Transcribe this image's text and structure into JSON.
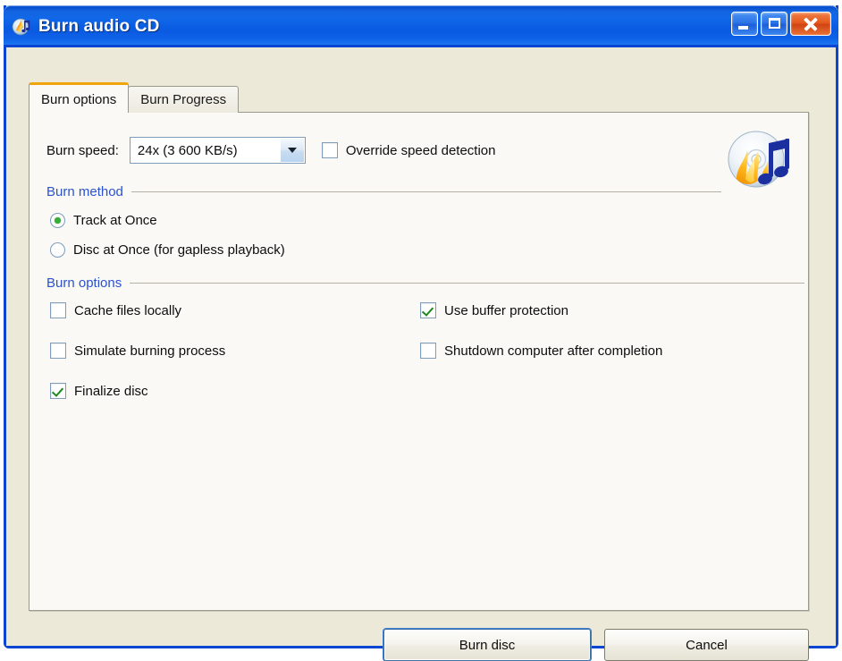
{
  "window": {
    "title": "Burn audio CD",
    "icon": "cd-burn-icon",
    "buttons": {
      "minimize": "Minimize",
      "maximize": "Maximize",
      "close": "Close"
    }
  },
  "tabs": [
    {
      "label": "Burn options",
      "active": true
    },
    {
      "label": "Burn Progress",
      "active": false
    }
  ],
  "burn_speed": {
    "label": "Burn speed:",
    "selected": "24x (3 600 KB/s)",
    "override": {
      "label": "Override speed detection",
      "checked": false
    }
  },
  "burn_method": {
    "title": "Burn method",
    "options": [
      {
        "label": "Track at Once",
        "selected": true
      },
      {
        "label": "Disc at Once (for gapless playback)",
        "selected": false
      }
    ]
  },
  "burn_options": {
    "title": "Burn options",
    "left_column": [
      {
        "label": "Cache files locally",
        "checked": false
      },
      {
        "label": "Simulate burning process",
        "checked": false
      },
      {
        "label": "Finalize disc",
        "checked": true
      }
    ],
    "right_column": [
      {
        "label": "Use buffer protection",
        "checked": true
      },
      {
        "label": "Shutdown computer after completion",
        "checked": false
      }
    ]
  },
  "footer": {
    "primary": "Burn disc",
    "secondary": "Cancel"
  },
  "colors": {
    "titlebar_blue": "#0b5fe4",
    "window_border": "#0a46d2",
    "dialog_face": "#ece9d8",
    "panel_face": "#faf9f5",
    "group_label": "#2b52cf",
    "active_tab_accent": "#f0a30a",
    "check_green": "#1a8a1a",
    "radio_green": "#35b035",
    "close_orange": "#e55a1e"
  }
}
